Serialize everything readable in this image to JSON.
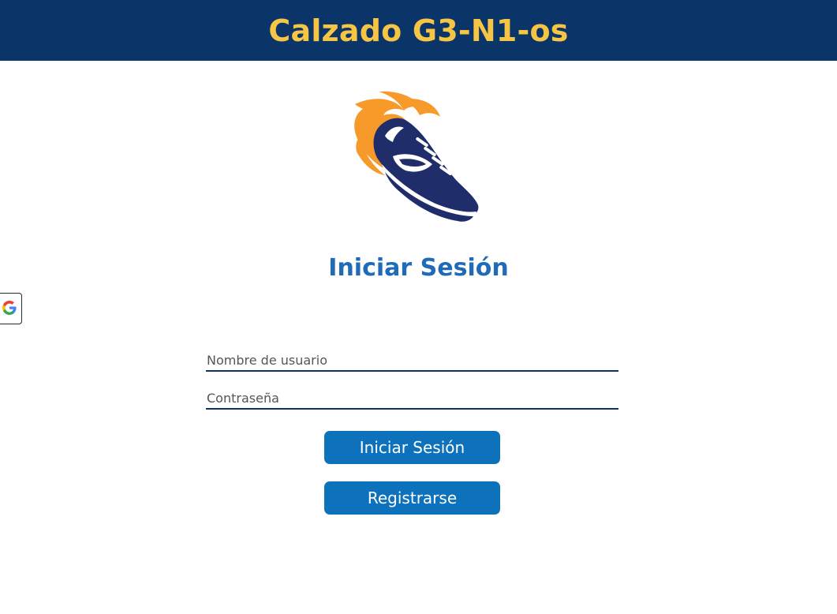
{
  "header": {
    "title": "Calzado G3-N1-os"
  },
  "logo": {
    "icon": "flaming-sneaker-icon",
    "colors": {
      "flame": "#f79a2a",
      "shoe": "#1f2d6b"
    }
  },
  "login": {
    "heading": "Iniciar Sesión",
    "username_placeholder": "Nombre de usuario",
    "password_placeholder": "Contraseña",
    "login_button": "Iniciar Sesión",
    "register_button": "Registrarse"
  },
  "google_button": {
    "icon": "google-icon",
    "letter": "G"
  },
  "colors": {
    "header_bg": "#0b3469",
    "header_title": "#f6c543",
    "heading": "#1f6bb8",
    "button": "#0d72bb",
    "field_underline": "#0b3469"
  }
}
